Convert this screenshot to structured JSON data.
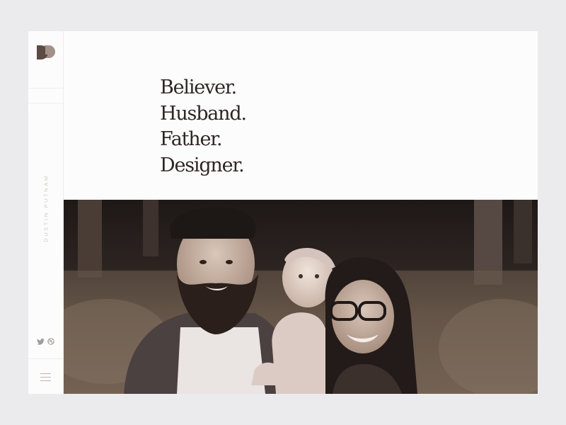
{
  "site": {
    "owner_name": "DUSTIN PUTNAM",
    "logo_letters": "DP"
  },
  "hero": {
    "lines": [
      "Believer.",
      "Husband.",
      "Father.",
      "Designer."
    ]
  },
  "social": {
    "icons": [
      "twitter-icon",
      "dribbble-icon"
    ]
  },
  "menu": {
    "icon": "hamburger-menu-icon"
  },
  "colors": {
    "page_background": "#ebebed",
    "panel_background": "#fdfcfd",
    "headline_text": "#2e2623",
    "logo_dark": "#5d4a42",
    "logo_light": "#a39189",
    "sidebar_text": "#d0c8c4",
    "photo_tone": "#2b2320"
  }
}
